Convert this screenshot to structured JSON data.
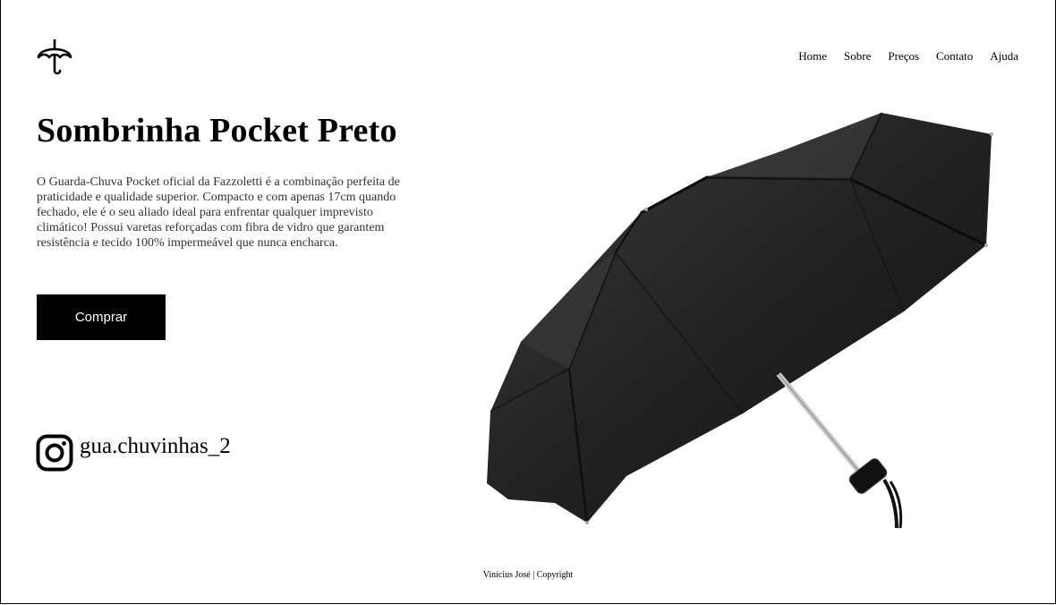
{
  "nav": {
    "items": [
      {
        "label": "Home"
      },
      {
        "label": "Sobre"
      },
      {
        "label": "Preços"
      },
      {
        "label": "Contato"
      },
      {
        "label": "Ajuda"
      }
    ]
  },
  "hero": {
    "title": "Sombrinha Pocket Preto",
    "description": "O Guarda-Chuva Pocket oficial da Fazzoletti é a combinação perfeita de praticidade e qualidade superior. Compacto e com apenas 17cm quando fechado, ele é o seu aliado ideal para enfrentar qualquer imprevisto climático! Possui varetas reforçadas com fibra de vidro que garantem resistência e tecido 100% impermeável que nunca encharca.",
    "buy_label": "Comprar"
  },
  "social": {
    "icon": "instagram-icon",
    "handle": "gua.chuvinhas_2"
  },
  "footer": {
    "text": "Vinícius José | Copyright"
  },
  "icons": {
    "logo": "umbrella-icon"
  },
  "colors": {
    "background": "#ffffff",
    "text": "#000000",
    "button": "#000000",
    "button_text": "#ffffff"
  }
}
